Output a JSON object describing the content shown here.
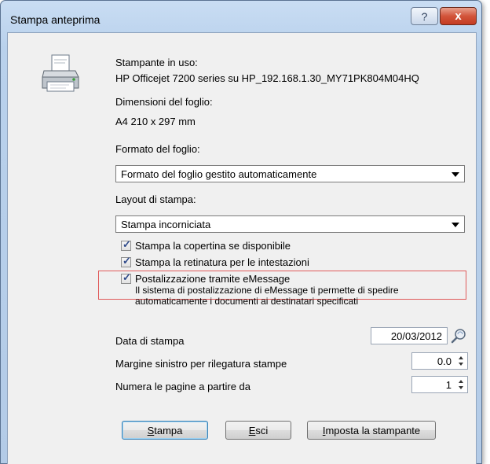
{
  "window": {
    "title": "Stampa anteprima",
    "help_label": "?",
    "close_label": "x"
  },
  "printer": {
    "label": "Stampante in uso:",
    "value": "HP Officejet 7200 series su HP_192.168.1.30_MY71PK804M04HQ",
    "sheet_label": "Dimensioni del foglio:",
    "sheet_value": "A4 210 x 297 mm"
  },
  "format": {
    "label": "Formato del foglio:",
    "selected": "Formato del foglio gestito automaticamente"
  },
  "layout": {
    "label": "Layout di stampa:",
    "selected": "Stampa incorniciata"
  },
  "options": [
    {
      "label": "Stampa la copertina se disponibile",
      "checked": true
    },
    {
      "label": "Stampa la retinatura per le intestazioni",
      "checked": true
    },
    {
      "label": "Postalizzazione tramite eMessage",
      "checked": true
    }
  ],
  "emessage_description": {
    "line1": "Il sistema di postalizzazione di eMessage ti permette di spedire",
    "line2": "automaticamente i documenti ai destinatari specificati"
  },
  "print_date": {
    "label": "Data di stampa",
    "value": "20/03/2012"
  },
  "margin": {
    "label": "Margine sinistro per rilegatura stampe",
    "value": "0.0"
  },
  "page_start": {
    "label": "Numera le pagine a partire da",
    "value": "1"
  },
  "buttons": {
    "print_first": "S",
    "print_rest": "tampa",
    "exit_first": "E",
    "exit_rest": "sci",
    "setup_first": "I",
    "setup_rest": "mposta la stampante"
  },
  "icons": {
    "printer": "printer-icon",
    "calendar": "calendar-picker-icon"
  }
}
